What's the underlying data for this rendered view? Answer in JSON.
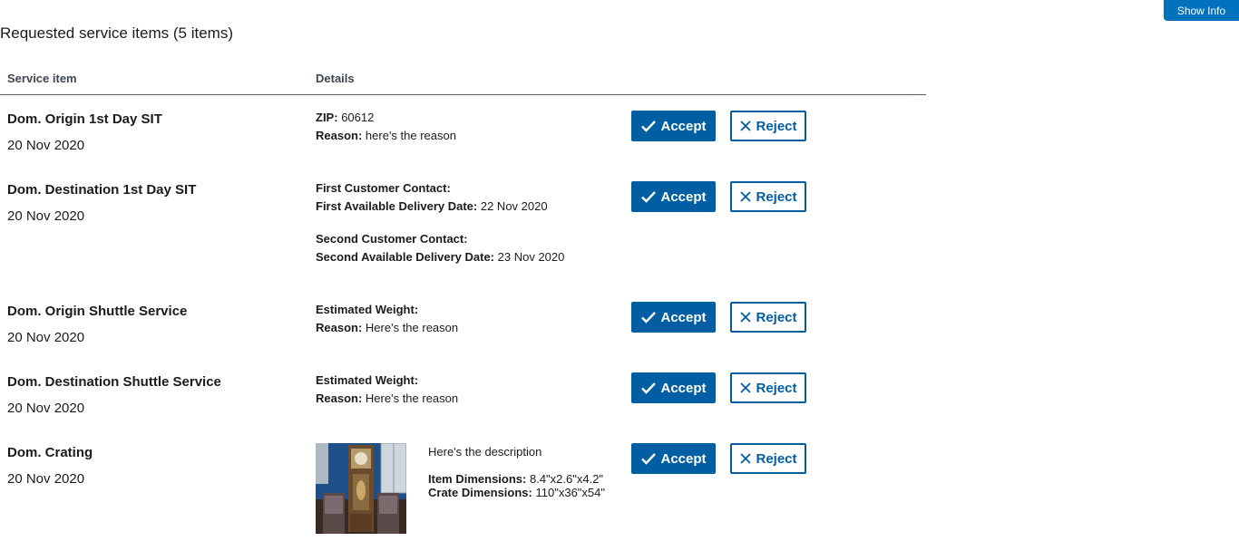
{
  "header": {
    "show_info_label": "Show Info"
  },
  "page": {
    "title": "Requested service items (5 items)"
  },
  "table": {
    "columns": {
      "service": "Service item",
      "details": "Details"
    },
    "accept_label": "Accept",
    "reject_label": "Reject",
    "rows": [
      {
        "name": "Dom. Origin 1st Day SIT",
        "date": "20 Nov 2020",
        "zip_label": "ZIP:",
        "zip": "60612",
        "reason_label": "Reason:",
        "reason": "here's the reason"
      },
      {
        "name": "Dom. Destination 1st Day SIT",
        "date": "20 Nov 2020",
        "first_contact_label": "First Customer Contact:",
        "first_delivery_label": "First Available Delivery Date:",
        "first_delivery": "22 Nov 2020",
        "second_contact_label": "Second Customer Contact:",
        "second_delivery_label": "Second Available Delivery Date:",
        "second_delivery": "23 Nov 2020"
      },
      {
        "name": "Dom. Origin Shuttle Service",
        "date": "20 Nov 2020",
        "weight_label": "Estimated Weight:",
        "reason_label": "Reason:",
        "reason": "Here's the reason"
      },
      {
        "name": "Dom. Destination Shuttle Service",
        "date": "20 Nov 2020",
        "weight_label": "Estimated Weight:",
        "reason_label": "Reason:",
        "reason": "Here's the reason"
      },
      {
        "name": "Dom. Crating",
        "date": "20 Nov 2020",
        "description": "Here's the description",
        "item_dims_label": "Item Dimensions:",
        "item_dims": "8.4\"x2.6\"x4.2\"",
        "crate_dims_label": "Crate Dimensions:",
        "crate_dims": "110\"x36\"x54\""
      }
    ]
  },
  "icons": {
    "accept": "check-icon",
    "reject": "close-icon"
  },
  "colors": {
    "primary": "#005ea2",
    "info_button": "#0071bc",
    "text": "#1b1b1b"
  }
}
